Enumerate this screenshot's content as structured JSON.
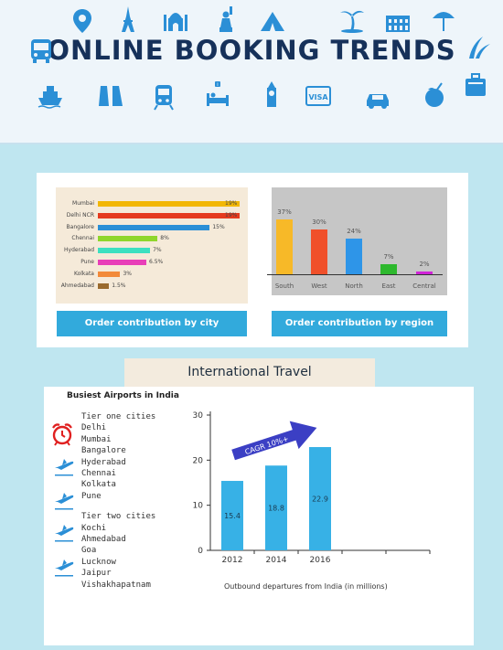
{
  "banner": {
    "title": "ONLINE BOOKING TRENDS",
    "icons": [
      "map-pin-icon",
      "eiffel-tower-icon",
      "taj-mahal-icon",
      "statue-of-liberty-icon",
      "tent-icon",
      "palm-tree-icon",
      "colosseum-icon",
      "beach-umbrella-icon",
      "bus-icon",
      "palm-leaves-icon",
      "ship-icon",
      "flippers-icon",
      "train-icon",
      "hotel-bed-icon",
      "big-ben-icon",
      "visa-card-icon",
      "car-icon",
      "cocktail-icon",
      "luggage-icon"
    ],
    "accent": "#2b8fd6"
  },
  "city_chart": {
    "button": "Order contribution by city"
  },
  "region_chart": {
    "button": "Order contribution by region"
  },
  "international": {
    "heading": "International Travel",
    "airports_title": "Busiest Airports in India",
    "tier_one": [
      "Tier one cities",
      "Delhi",
      "Mumbai",
      "Bangalore",
      "Hyderabad",
      "Chennai",
      "Kolkata",
      "Pune"
    ],
    "tier_two": [
      "Tier two cities",
      "Kochi",
      "Ahmedabad",
      "Goa",
      "Lucknow",
      "Jaipur",
      "Vishakhapatnam"
    ],
    "cagr_label": "CAGR 10%+",
    "note": "Outbound departures from India (in millions)"
  },
  "chart_data": [
    {
      "type": "bar",
      "orientation": "horizontal",
      "categories": [
        "Mumbai",
        "Delhi NCR",
        "Bangalore",
        "Chennai",
        "Hyderabad",
        "Pune",
        "Kolkata",
        "Ahmedabad"
      ],
      "values": [
        19,
        19,
        15,
        8,
        7,
        6.5,
        3,
        1.5
      ],
      "labels": [
        "19%",
        "19%",
        "15%",
        "8%",
        "7%",
        "6.5%",
        "3%",
        "1.5%"
      ],
      "colors": [
        "#f2b705",
        "#e53a1e",
        "#2b8fd6",
        "#8fd62b",
        "#3de0c0",
        "#e83fb8",
        "#f28a3a",
        "#9a6a2e"
      ],
      "xlim": [
        0,
        19
      ]
    },
    {
      "type": "bar",
      "categories": [
        "South",
        "West",
        "North",
        "East",
        "Central"
      ],
      "values": [
        37,
        30,
        24,
        7,
        2
      ],
      "labels": [
        "37%",
        "30%",
        "24%",
        "7%",
        "2%"
      ],
      "colors": [
        "#f7b928",
        "#f0502a",
        "#2e95e8",
        "#2db82d",
        "#d024d8"
      ],
      "ylim": [
        0,
        40
      ]
    },
    {
      "type": "bar",
      "categories": [
        "2012",
        "2014",
        "2016",
        "",
        ""
      ],
      "values": [
        15.4,
        18.8,
        22.9,
        null,
        null
      ],
      "labels": [
        "15.4",
        "18.8",
        "22.9"
      ],
      "color": "#37b1e6",
      "yticks": [
        0,
        10,
        20,
        30
      ],
      "ylim": [
        0,
        30
      ]
    }
  ]
}
